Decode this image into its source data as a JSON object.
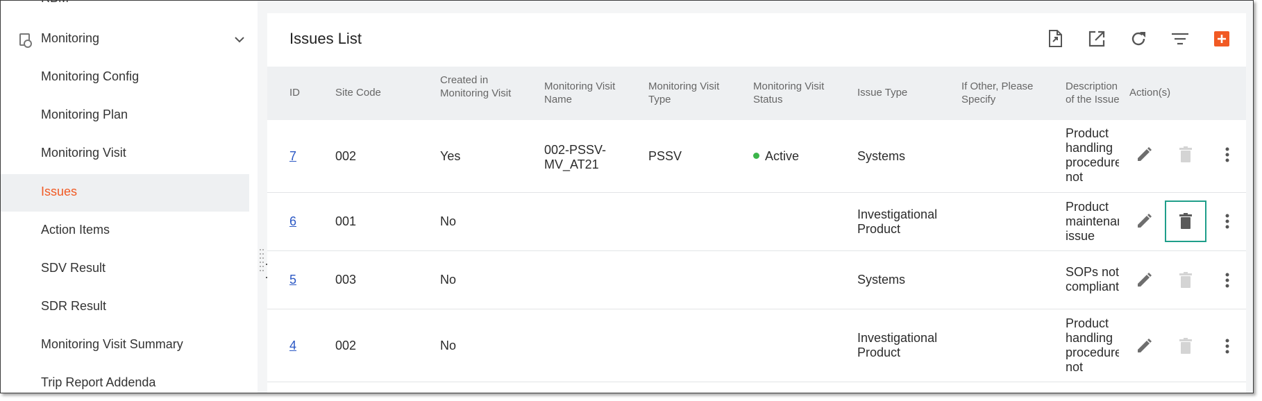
{
  "sidebar": {
    "top_item": "RBM",
    "group_label": "Monitoring",
    "items": [
      {
        "label": "Monitoring Config"
      },
      {
        "label": "Monitoring Plan"
      },
      {
        "label": "Monitoring Visit"
      },
      {
        "label": "Issues",
        "active": true
      },
      {
        "label": "Action Items"
      },
      {
        "label": "SDV Result"
      },
      {
        "label": "SDR Result"
      },
      {
        "label": "Monitoring Visit Summary"
      },
      {
        "label": "Trip Report Addenda"
      }
    ]
  },
  "main": {
    "title": "Issues List",
    "toolbar": {
      "icons": [
        "export-file-icon",
        "open-external-icon",
        "refresh-icon",
        "filter-icon",
        "add-icon"
      ],
      "add_color": "#f15a24"
    },
    "columns": {
      "id": "ID",
      "site_code": "Site Code",
      "created_in_visit": "Created in Monitoring Visit",
      "visit_name": "Monitoring Visit Name",
      "visit_type": "Monitoring Visit Type",
      "visit_status": "Monitoring Visit Status",
      "issue_type": "Issue Type",
      "if_other": "If Other, Please Specify",
      "description": "Description of the Issue",
      "actions": "Action(s)"
    },
    "rows": [
      {
        "id": "7",
        "site_code": "002",
        "created_in_visit": "Yes",
        "visit_name": "002-PSSV-MV_AT21",
        "visit_type": "PSSV",
        "visit_status": "Active",
        "issue_type": "Systems",
        "if_other": "",
        "description": "Product handling procedure not followed",
        "delete_enabled": false
      },
      {
        "id": "6",
        "site_code": "001",
        "created_in_visit": "No",
        "visit_name": "",
        "visit_type": "",
        "visit_status": "",
        "issue_type": "Investigational Product",
        "if_other": "",
        "description": "Product maintenance issue",
        "delete_enabled": true
      },
      {
        "id": "5",
        "site_code": "003",
        "created_in_visit": "No",
        "visit_name": "",
        "visit_type": "",
        "visit_status": "",
        "issue_type": "Systems",
        "if_other": "",
        "description": "SOPs not compliant",
        "delete_enabled": false
      },
      {
        "id": "4",
        "site_code": "002",
        "created_in_visit": "No",
        "visit_name": "",
        "visit_type": "",
        "visit_status": "",
        "issue_type": "Investigational Product",
        "if_other": "",
        "description": "Product handling procedure not followed",
        "delete_enabled": false
      }
    ],
    "colors": {
      "active_status": "#3bb54a",
      "link": "#2a57c4",
      "active_nav": "#f15a24",
      "highlight_outline": "#1f9e8a"
    }
  }
}
